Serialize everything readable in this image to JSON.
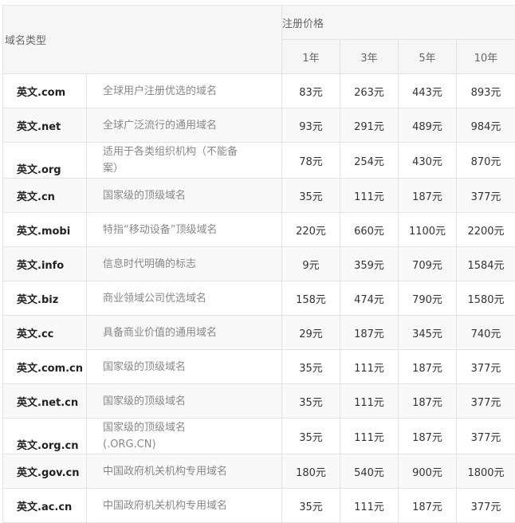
{
  "header": {
    "domain_type": "域名类型",
    "register_price": "注册价格",
    "years": [
      "1年",
      "3年",
      "5年",
      "10年"
    ]
  },
  "rows": [
    {
      "name": "英文.com",
      "desc": "全球用户注册优选的域名",
      "prices": [
        "83元",
        "263元",
        "443元",
        "893元"
      ]
    },
    {
      "name": "英文.net",
      "desc": "全球广泛流行的通用域名",
      "prices": [
        "93元",
        "291元",
        "489元",
        "984元"
      ]
    },
    {
      "name": "英文.org",
      "desc": "适用于各类组织机构（不能备案）",
      "prices": [
        "78元",
        "254元",
        "430元",
        "870元"
      ]
    },
    {
      "name": "英文.cn",
      "desc": "国家级的顶级域名",
      "prices": [
        "35元",
        "111元",
        "187元",
        "377元"
      ]
    },
    {
      "name": "英文.mobi",
      "desc": "特指“移动设备”顶级域名",
      "prices": [
        "220元",
        "660元",
        "1100元",
        "2200元"
      ]
    },
    {
      "name": "英文.info",
      "desc": "信息时代明确的标志",
      "prices": [
        "9元",
        "359元",
        "709元",
        "1584元"
      ]
    },
    {
      "name": "英文.biz",
      "desc": "商业领域公司优选域名",
      "prices": [
        "158元",
        "474元",
        "790元",
        "1580元"
      ]
    },
    {
      "name": "英文.cc",
      "desc": "具备商业价值的通用域名",
      "prices": [
        "29元",
        "187元",
        "345元",
        "740元"
      ]
    },
    {
      "name": "英文.com.cn",
      "desc": "国家级的顶级域名",
      "prices": [
        "35元",
        "111元",
        "187元",
        "377元"
      ]
    },
    {
      "name": "英文.net.cn",
      "desc": "国家级的顶级域名",
      "prices": [
        "35元",
        "111元",
        "187元",
        "377元"
      ]
    },
    {
      "name": "英文.org.cn",
      "desc": "国家级的顶级域名(.ORG.CN)",
      "prices": [
        "35元",
        "111元",
        "187元",
        "377元"
      ]
    },
    {
      "name": "英文.gov.cn",
      "desc": "中国政府机关机构专用域名",
      "prices": [
        "180元",
        "540元",
        "900元",
        "1800元"
      ]
    },
    {
      "name": "英文.ac.cn",
      "desc": "中国政府机关机构专用域名",
      "prices": [
        "35元",
        "111元",
        "187元",
        "377元"
      ]
    }
  ]
}
